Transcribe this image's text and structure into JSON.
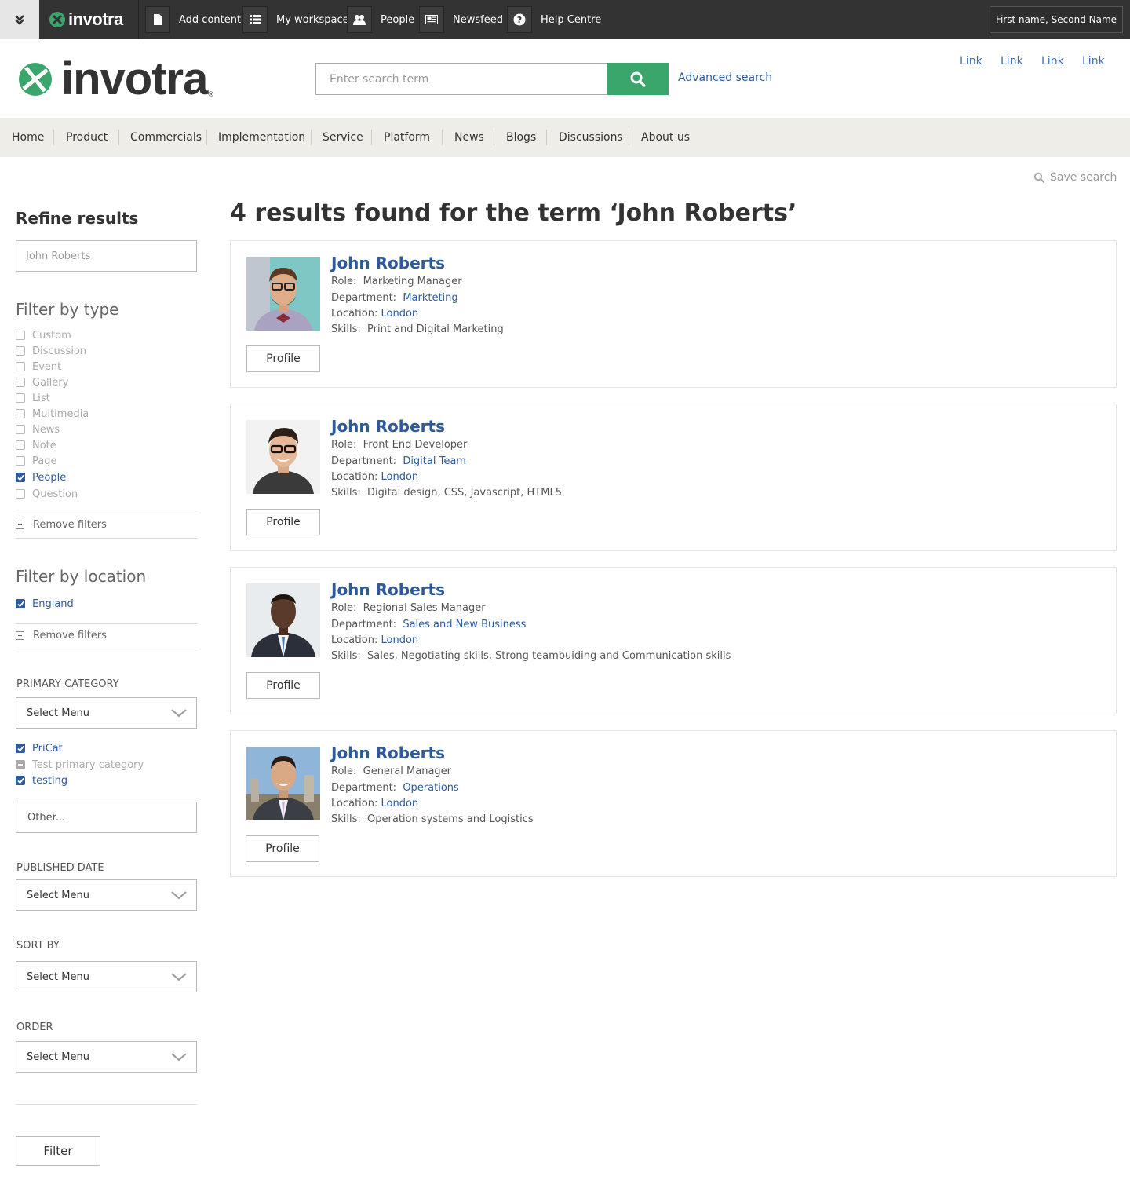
{
  "topbar": {
    "logo_text": "invotra",
    "items": [
      {
        "label": "Add content",
        "icon": "document-icon"
      },
      {
        "label": "My workspace",
        "icon": "list-icon"
      },
      {
        "label": "People",
        "icon": "people-icon"
      },
      {
        "label": "Newsfeed",
        "icon": "newspaper-icon"
      },
      {
        "label": "Help Centre",
        "icon": "question-icon"
      }
    ],
    "user_label": "First name, Second Name"
  },
  "header": {
    "brand_text": "invotra",
    "brand_reg": "®",
    "search_placeholder": "Enter search term",
    "advanced_search": "Advanced search",
    "links": [
      "Link",
      "Link",
      "Link",
      "Link"
    ]
  },
  "nav": {
    "items": [
      "Home",
      "Product",
      "Commercials",
      "Implementation",
      "Service",
      "Platform",
      "News",
      "Blogs",
      "Discussions",
      "About us"
    ]
  },
  "save_search": "Save search",
  "sidebar": {
    "title": "Refine results",
    "search_value": "John Roberts",
    "filter_type_heading": "Filter by type",
    "types": [
      {
        "label": "Custom",
        "checked": false
      },
      {
        "label": "Discussion",
        "checked": false
      },
      {
        "label": "Event",
        "checked": false
      },
      {
        "label": "Gallery",
        "checked": false
      },
      {
        "label": "List",
        "checked": false
      },
      {
        "label": "Multimedia",
        "checked": false
      },
      {
        "label": "News",
        "checked": false
      },
      {
        "label": "Note",
        "checked": false
      },
      {
        "label": "Page",
        "checked": false
      },
      {
        "label": "People",
        "checked": true
      },
      {
        "label": "Question",
        "checked": false
      }
    ],
    "remove_filters": "Remove filters",
    "filter_location_heading": "Filter by location",
    "locations": [
      {
        "label": "England",
        "checked": true
      }
    ],
    "primary_category_label": "PRIMARY CATEGORY",
    "primary_category_select": "Select Menu",
    "categories": [
      {
        "label": "PriCat",
        "state": "checked"
      },
      {
        "label": "Test primary category",
        "state": "indeterminate"
      },
      {
        "label": "testing",
        "state": "checked"
      }
    ],
    "other_placeholder": "Other...",
    "published_date_label": "PUBLISHED DATE",
    "published_date_select": "Select Menu",
    "sort_by_label": "SORT BY",
    "sort_by_select": "Select Menu",
    "order_label": "ORDER",
    "order_select": "Select Menu",
    "filter_button": "Filter"
  },
  "results": {
    "title": "4 results found for the term ‘John Roberts’",
    "labels": {
      "role": "Role:",
      "department": "Department:",
      "location": "Location:",
      "skills": "Skills:",
      "profile": "Profile"
    },
    "items": [
      {
        "name": "John Roberts",
        "role": "Marketing Manager",
        "department": "Markteting",
        "location": "London",
        "skills": "Print and Digital Marketing"
      },
      {
        "name": "John Roberts",
        "role": "Front End Developer",
        "department": "Digital Team",
        "location": "London",
        "skills": "Digital design, CSS, Javascript, HTML5"
      },
      {
        "name": "John Roberts",
        "role": "Regional Sales Manager",
        "department": "Sales and New Business",
        "location": "London",
        "skills": "Sales, Negotiating skills, Strong teambuiding and Communication skills"
      },
      {
        "name": "John Roberts",
        "role": "General Manager",
        "department": "Operations",
        "location": "London",
        "skills": "Operation systems and Logistics"
      }
    ]
  },
  "colors": {
    "topbar_bg": "#333333",
    "accent_green": "#3aa66c",
    "link_blue": "#2d5a9a",
    "nav_bg": "#eeede8"
  }
}
